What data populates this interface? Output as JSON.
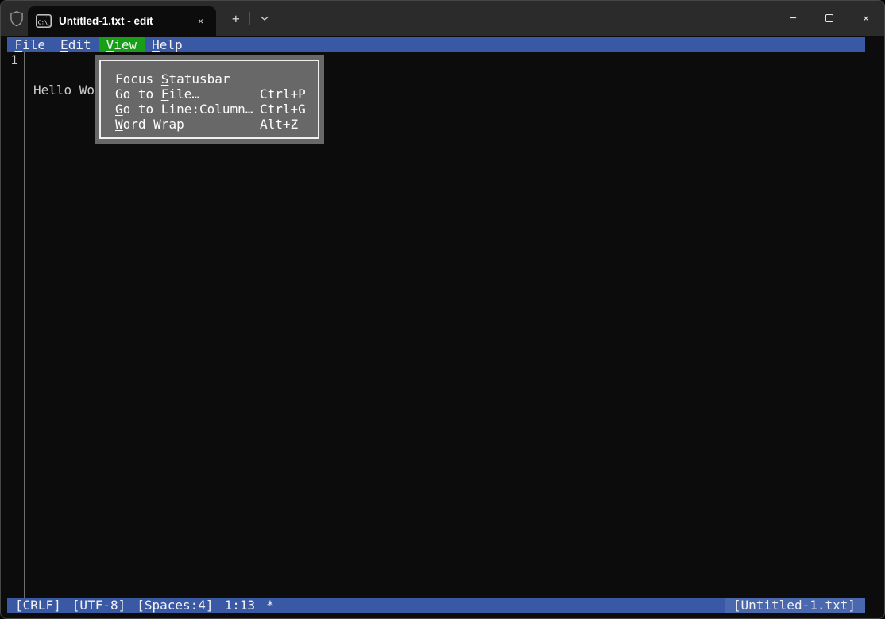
{
  "colors": {
    "titlebar_bg": "#2b2b2b",
    "terminal_bg": "#0c0c0c",
    "bar_blue": "#3a59a5",
    "menu_highlight_green": "#17a017",
    "dropdown_bg": "#686868",
    "dropdown_border": "#f0f0f0",
    "editor_text": "#cccccc",
    "statusbar_filename_highlight": "#4a68ae"
  },
  "titlebar": {
    "tab_title": "Untitled-1.txt - edit",
    "icons": {
      "shield": "admin-shield-outline",
      "tab_app": "command-prompt-window",
      "tab_close": "✕",
      "new_tab": "+",
      "dropdown_chevron": "chevron-down",
      "minimize": "─",
      "maximize": "square-outline",
      "close": "✕"
    }
  },
  "menubar": {
    "items": [
      {
        "pre": "",
        "key": "F",
        "post": "ile"
      },
      {
        "pre": "",
        "key": "E",
        "post": "dit"
      },
      {
        "pre": "",
        "key": "V",
        "post": "iew"
      },
      {
        "pre": "",
        "key": "H",
        "post": "elp"
      }
    ],
    "active_item": "View"
  },
  "view_menu": {
    "items": [
      {
        "pre": "Focus ",
        "key": "S",
        "post": "tatusbar",
        "shortcut": ""
      },
      {
        "pre": "Go to ",
        "key": "F",
        "post": "ile…",
        "shortcut": "Ctrl+P"
      },
      {
        "pre": "",
        "key": "G",
        "post": "o to Line:Column…",
        "shortcut": "Ctrl+G"
      },
      {
        "pre": "",
        "key": "W",
        "post": "ord Wrap",
        "shortcut": "Alt+Z"
      }
    ]
  },
  "editor": {
    "line_number": "1",
    "line_text": "Hello Wo"
  },
  "statusbar": {
    "line_ending": "[CRLF]",
    "encoding": "[UTF-8]",
    "indentation": "[Spaces:4]",
    "cursor_position": "1:13",
    "modified_indicator": "*",
    "filename": "[Untitled-1.txt]"
  }
}
